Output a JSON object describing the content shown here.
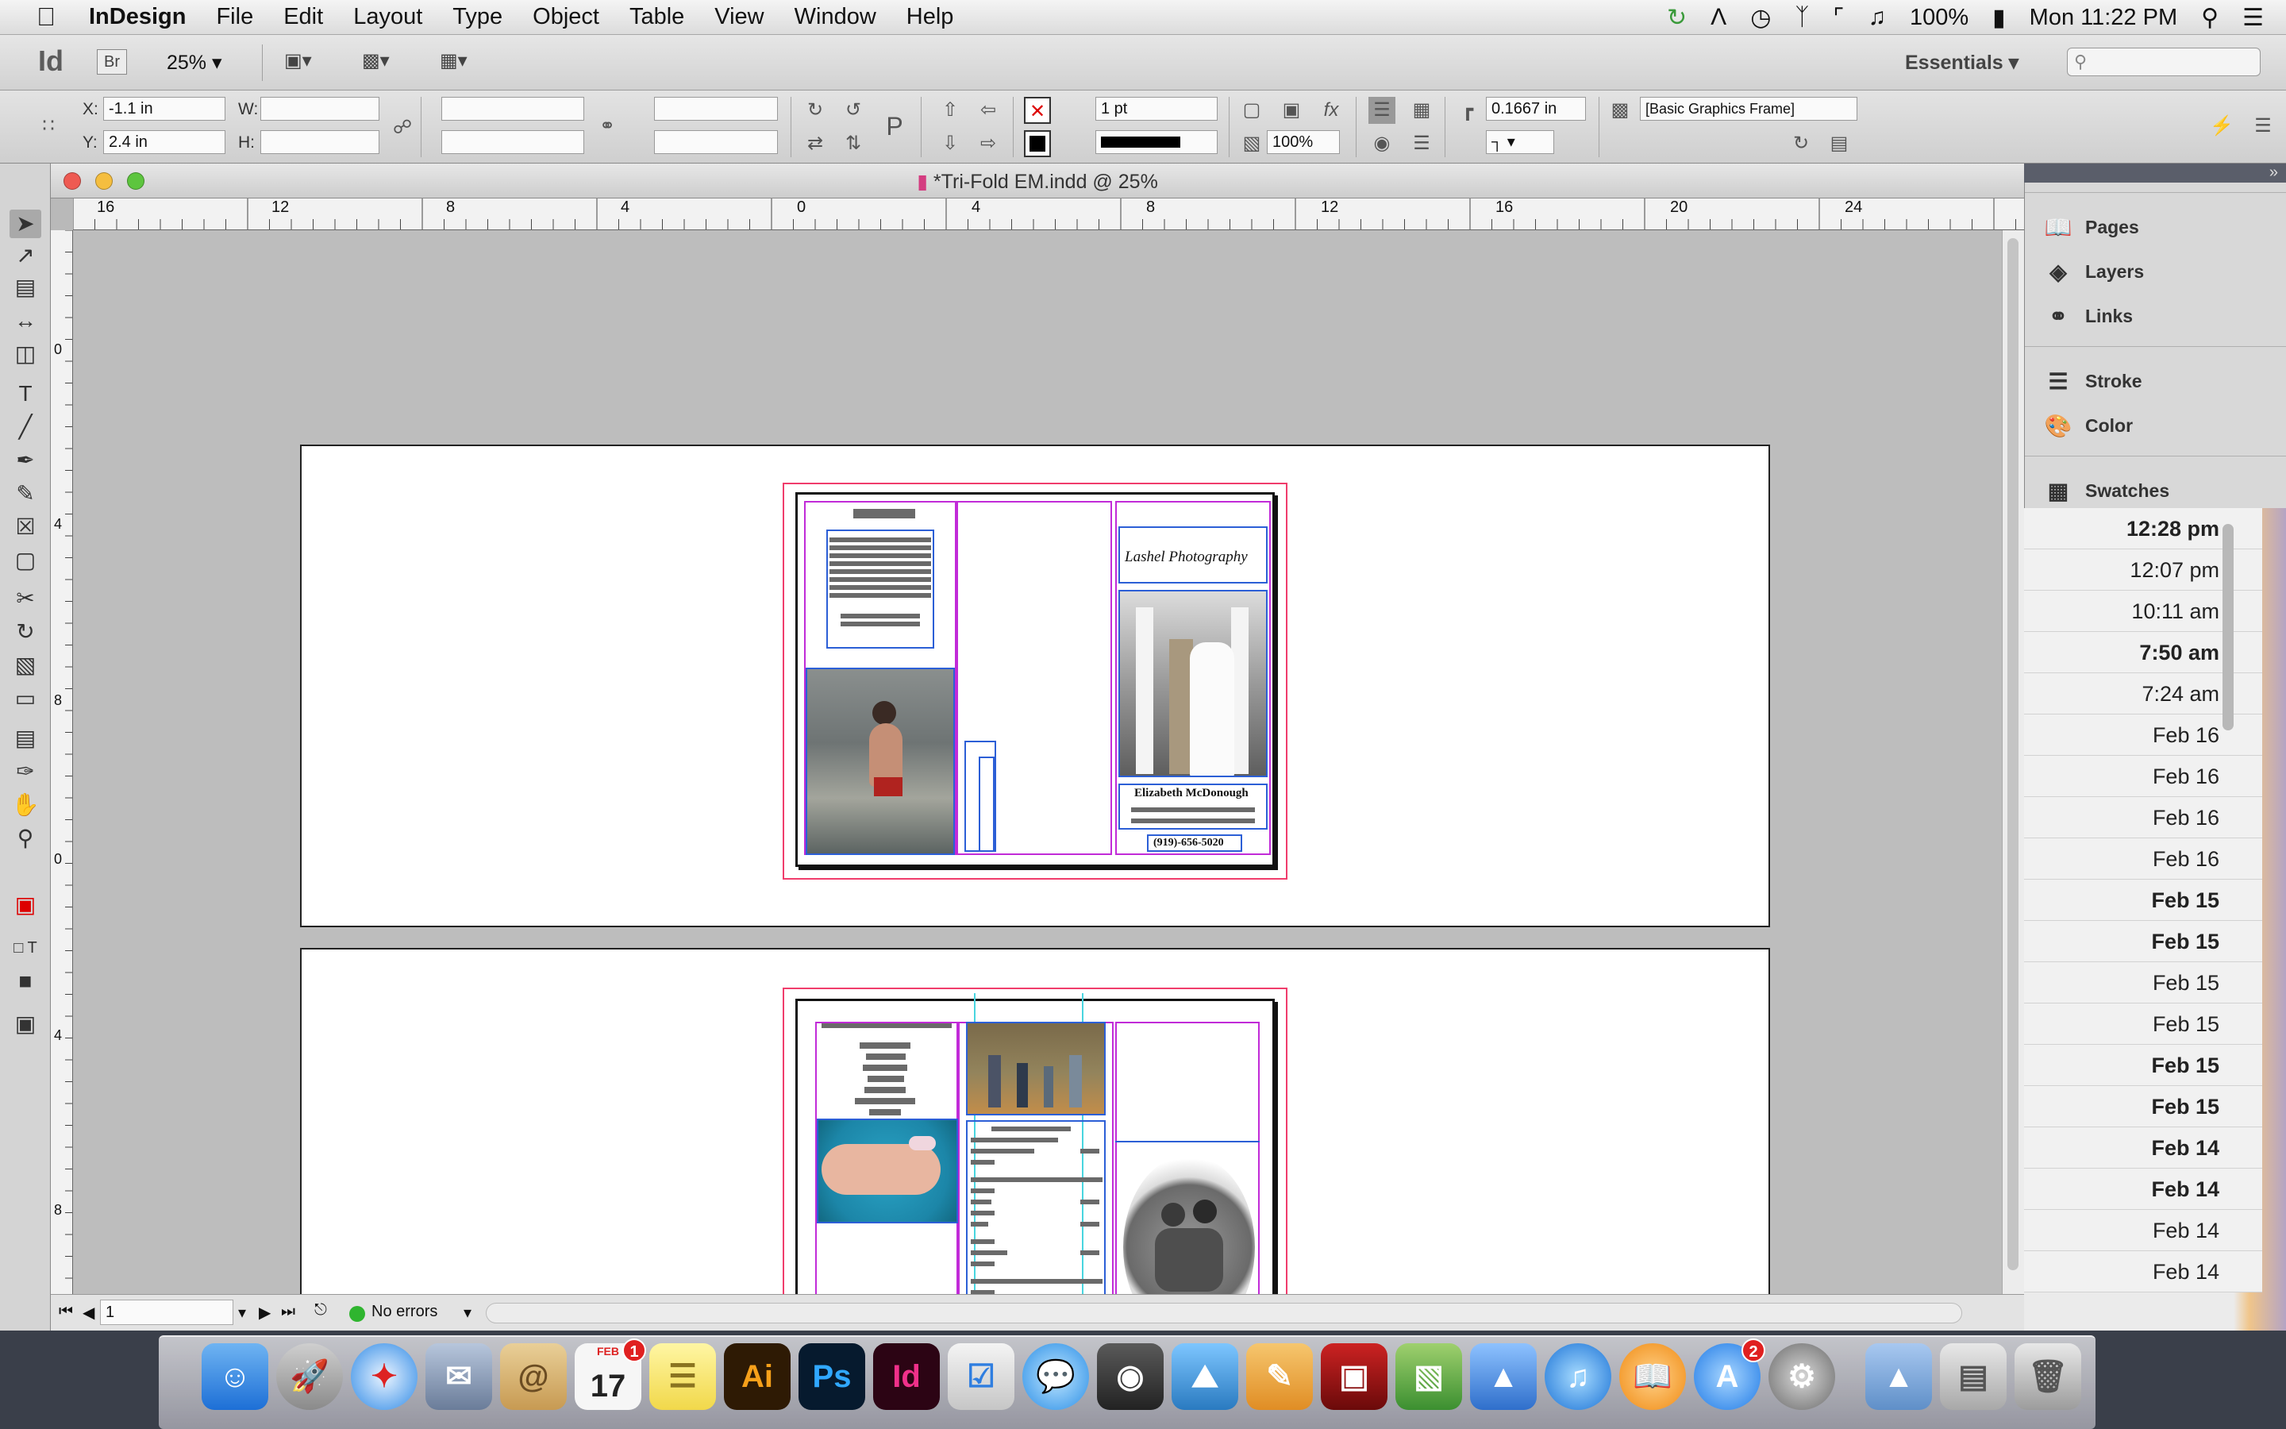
{
  "menubar": {
    "apple": "",
    "items": [
      "InDesign",
      "File",
      "Edit",
      "Layout",
      "Type",
      "Object",
      "Table",
      "View",
      "Window",
      "Help"
    ],
    "battery": "100%",
    "clock": "Mon 11:22 PM"
  },
  "appbar": {
    "logo": "Id",
    "bridge": "Br",
    "zoom": "25%",
    "workspace": "Essentials",
    "search_placeholder": ""
  },
  "control": {
    "x_label": "X:",
    "x_value": "-1.1 in",
    "y_label": "Y:",
    "y_value": "2.4 in",
    "w_label": "W:",
    "w_value": "",
    "h_label": "H:",
    "h_value": "",
    "stroke_weight": "1 pt",
    "opacity": "100%",
    "offset": "0.1667 in",
    "object_style": "[Basic Graphics Frame]"
  },
  "document": {
    "title": "*Tri-Fold EM.indd @ 25%",
    "ruler_labels": [
      "16",
      "12",
      "8",
      "4",
      "0",
      "4",
      "8",
      "12",
      "16",
      "20",
      "24"
    ],
    "vruler_labels": [
      "0",
      "4",
      "8",
      "0",
      "4",
      "8"
    ],
    "page1": {
      "name_caption": "Elizabeth McDonough",
      "phone_caption": "(919)-656-5020",
      "logo_text": "Lashel Photography"
    },
    "status": {
      "page": "1",
      "preflight": "No errors"
    }
  },
  "panels": {
    "items": [
      {
        "label": "Pages",
        "icon": "pages-icon"
      },
      {
        "label": "Layers",
        "icon": "layers-icon"
      },
      {
        "label": "Links",
        "icon": "links-icon"
      },
      {
        "label": "Stroke",
        "icon": "stroke-icon"
      },
      {
        "label": "Color",
        "icon": "color-icon"
      },
      {
        "label": "Swatches",
        "icon": "swatches-icon"
      }
    ]
  },
  "finder_dates": [
    {
      "text": "12:28 pm",
      "bold": true
    },
    {
      "text": "12:07 pm",
      "bold": false
    },
    {
      "text": "10:11 am",
      "bold": false
    },
    {
      "text": "7:50 am",
      "bold": true
    },
    {
      "text": "7:24 am",
      "bold": false
    },
    {
      "text": "Feb 16",
      "bold": false
    },
    {
      "text": "Feb 16",
      "bold": false
    },
    {
      "text": "Feb 16",
      "bold": false
    },
    {
      "text": "Feb 16",
      "bold": false
    },
    {
      "text": "Feb 15",
      "bold": true
    },
    {
      "text": "Feb 15",
      "bold": true
    },
    {
      "text": "Feb 15",
      "bold": false
    },
    {
      "text": "Feb 15",
      "bold": false
    },
    {
      "text": "Feb 15",
      "bold": true
    },
    {
      "text": "Feb 15",
      "bold": true
    },
    {
      "text": "Feb 14",
      "bold": true
    },
    {
      "text": "Feb 14",
      "bold": true
    },
    {
      "text": "Feb 14",
      "bold": false
    },
    {
      "text": "Feb 14",
      "bold": false
    }
  ],
  "dock": {
    "calendar_day": "17",
    "calendar_month": "FEB",
    "calendar_badge": "1",
    "appstore_badge": "2",
    "ai_label": "Ai",
    "ps_label": "Ps",
    "id_label": "Id"
  }
}
